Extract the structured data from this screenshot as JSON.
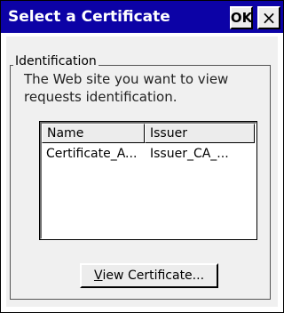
{
  "window": {
    "title": "Select a Certificate",
    "ok_label": "OK",
    "close_label": "×"
  },
  "identification": {
    "group_label": "Identification",
    "description": "The Web site you want to view requests identification."
  },
  "certificate_list": {
    "columns": [
      "Name",
      "Issuer"
    ],
    "rows": [
      {
        "name": "Certificate_A...",
        "issuer": "Issuer_CA_..."
      }
    ]
  },
  "view_button": {
    "mnemonic": "V",
    "label_rest": "iew Certificate..."
  },
  "colors": {
    "titlebar": "#0c02a6",
    "window_bg": "#f0f0f0"
  }
}
